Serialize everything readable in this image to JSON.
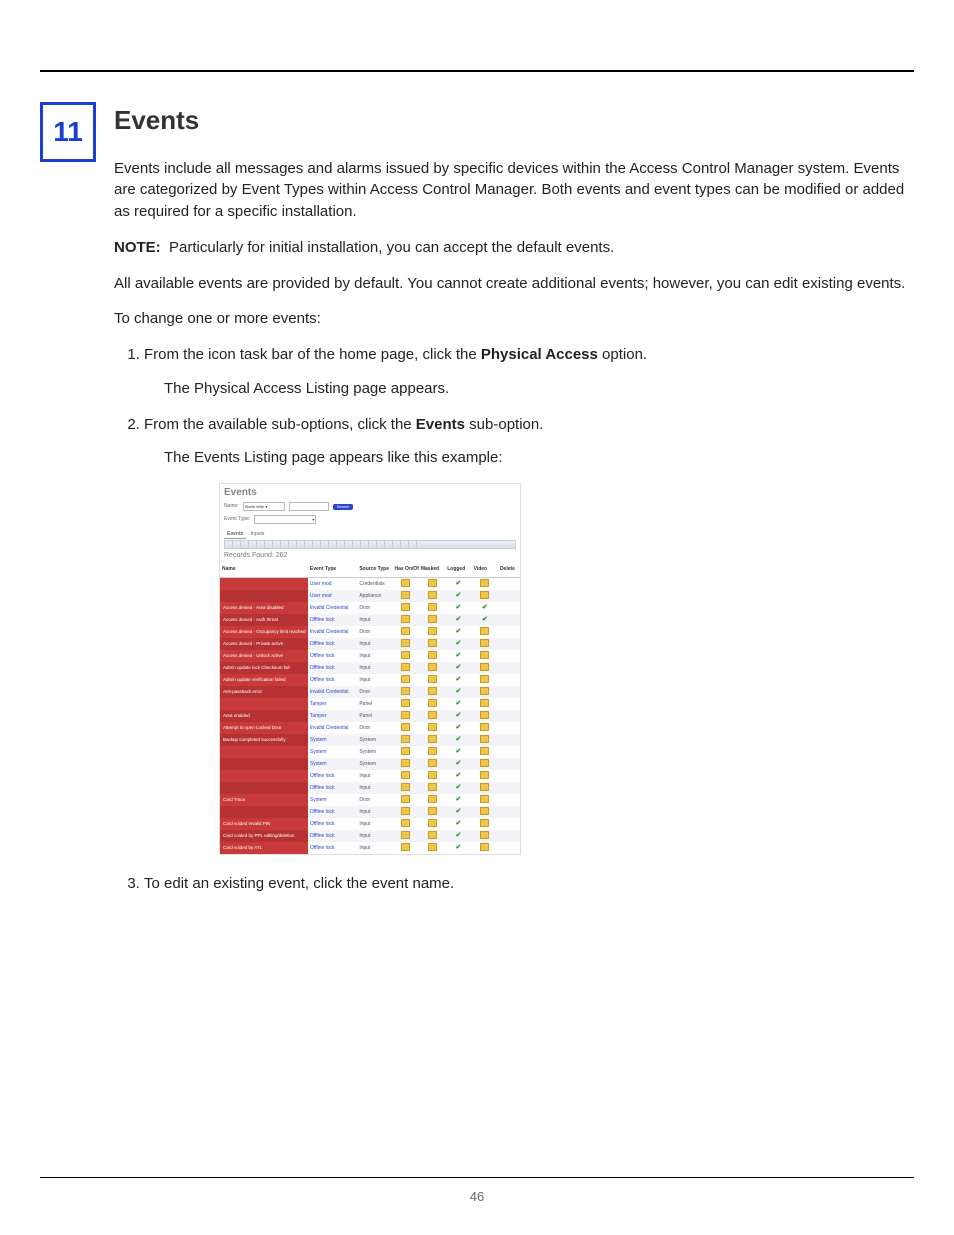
{
  "chapter_number": "11",
  "title": "Events",
  "paragraphs": {
    "intro": "Events include all messages and alarms issued by specific devices within the Access Control Manager system. Events are categorized by Event Types within Access Control Manager. Both events and event types can be modified or added as required for a specific installation.",
    "note_label": "NOTE:",
    "note_text": "Particularly for initial installation, you can accept the default events.",
    "p2": "All available events are provided by default. You cannot create additional events; however, you can edit existing events.",
    "p3": "To change one or more events:"
  },
  "steps": {
    "s1a": "From the icon task bar of the home page, click the ",
    "s1b": "Physical Access",
    "s1c": " option.",
    "s1_sub": "The Physical Access Listing page appears.",
    "s2a": "From the available sub-options, click the ",
    "s2b": "Events",
    "s2c": " sub-option.",
    "s2_sub": "The Events Listing page appears like this example:",
    "s3": "To edit an existing event, click the event name."
  },
  "screenshot": {
    "heading": "Events",
    "name_label": "Name:",
    "name_operator": "Starts With ▾",
    "event_type_label": "Event Type:",
    "search_button": "Search",
    "tabs": {
      "a": "Events",
      "b": "Inputs"
    },
    "records_found": "Records Found: 262",
    "columns": {
      "name": "Name",
      "event_type": "Event Type",
      "source_type": "Source Type",
      "has_onoff": "Has On/Off",
      "masked": "Masked",
      "logged": "Logged",
      "video": "Video",
      "delete": "Delete"
    },
    "rows": [
      {
        "name": "",
        "et": "User mod",
        "st": "Credentials",
        "f": [
          "x",
          "x",
          "c",
          "x"
        ]
      },
      {
        "name": "",
        "et": "User mod",
        "st": "Appliance",
        "f": [
          "x",
          "x",
          "c",
          "x"
        ]
      },
      {
        "name": "Access denied - Area disabled",
        "et": "Invalid Credential",
        "st": "Door",
        "f": [
          "x",
          "x",
          "c",
          "c"
        ]
      },
      {
        "name": "Access denied - Auth threat",
        "et": "Offline lock",
        "st": "Input",
        "f": [
          "x",
          "x",
          "c",
          "c"
        ]
      },
      {
        "name": "Access denied - Occupancy limit reached",
        "et": "Invalid Credential",
        "st": "Door",
        "f": [
          "x",
          "x",
          "c",
          "x"
        ]
      },
      {
        "name": "Access denied - Private active",
        "et": "Offline lock",
        "st": "Input",
        "f": [
          "x",
          "x",
          "c",
          "x"
        ]
      },
      {
        "name": "Access denied - Unlock active",
        "et": "Offline lock",
        "st": "Input",
        "f": [
          "x",
          "x",
          "c",
          "x"
        ]
      },
      {
        "name": "Admin update lock Checksum fail",
        "et": "Offline lock",
        "st": "Input",
        "f": [
          "x",
          "x",
          "c",
          "x"
        ]
      },
      {
        "name": "Admin update verification failed",
        "et": "Offline lock",
        "st": "Input",
        "f": [
          "x",
          "x",
          "c",
          "x"
        ]
      },
      {
        "name": "Anti-passback error",
        "et": "Invalid Credential",
        "st": "Door",
        "f": [
          "x",
          "x",
          "c",
          "x"
        ]
      },
      {
        "name": "",
        "et": "Tamper",
        "st": "Panel",
        "f": [
          "x",
          "x",
          "c",
          "x"
        ]
      },
      {
        "name": "Area enabled",
        "et": "Tamper",
        "st": "Panel",
        "f": [
          "x",
          "x",
          "c",
          "x"
        ]
      },
      {
        "name": "Attempt to open Locked Door",
        "et": "Invalid Credential",
        "st": "Door",
        "f": [
          "x",
          "x",
          "c",
          "x"
        ]
      },
      {
        "name": "Backup completed successfully",
        "et": "System",
        "st": "System",
        "f": [
          "x",
          "x",
          "c",
          "x"
        ]
      },
      {
        "name": "",
        "et": "System",
        "st": "System",
        "f": [
          "x",
          "x",
          "c",
          "x"
        ]
      },
      {
        "name": "",
        "et": "System",
        "st": "System",
        "f": [
          "x",
          "x",
          "c",
          "x"
        ]
      },
      {
        "name": "",
        "et": "Offline lock",
        "st": "Input",
        "f": [
          "x",
          "x",
          "c",
          "x"
        ]
      },
      {
        "name": "",
        "et": "Offline lock",
        "st": "Input",
        "f": [
          "x",
          "x",
          "c",
          "x"
        ]
      },
      {
        "name": "Card Trace",
        "et": "System",
        "st": "Door",
        "f": [
          "x",
          "x",
          "c",
          "x"
        ]
      },
      {
        "name": "",
        "et": "Offline lock",
        "st": "Input",
        "f": [
          "x",
          "x",
          "c",
          "x"
        ]
      },
      {
        "name": "Card voided Invalid PIN",
        "et": "Offline lock",
        "st": "Input",
        "f": [
          "x",
          "x",
          "c",
          "x"
        ]
      },
      {
        "name": "Card voided by PPL editing/deletion",
        "et": "Offline lock",
        "st": "Input",
        "f": [
          "x",
          "x",
          "c",
          "x"
        ]
      },
      {
        "name": "Card voided by ATL",
        "et": "Offline lock",
        "st": "Input",
        "f": [
          "x",
          "x",
          "c",
          "x"
        ]
      }
    ]
  },
  "page_number": "46"
}
